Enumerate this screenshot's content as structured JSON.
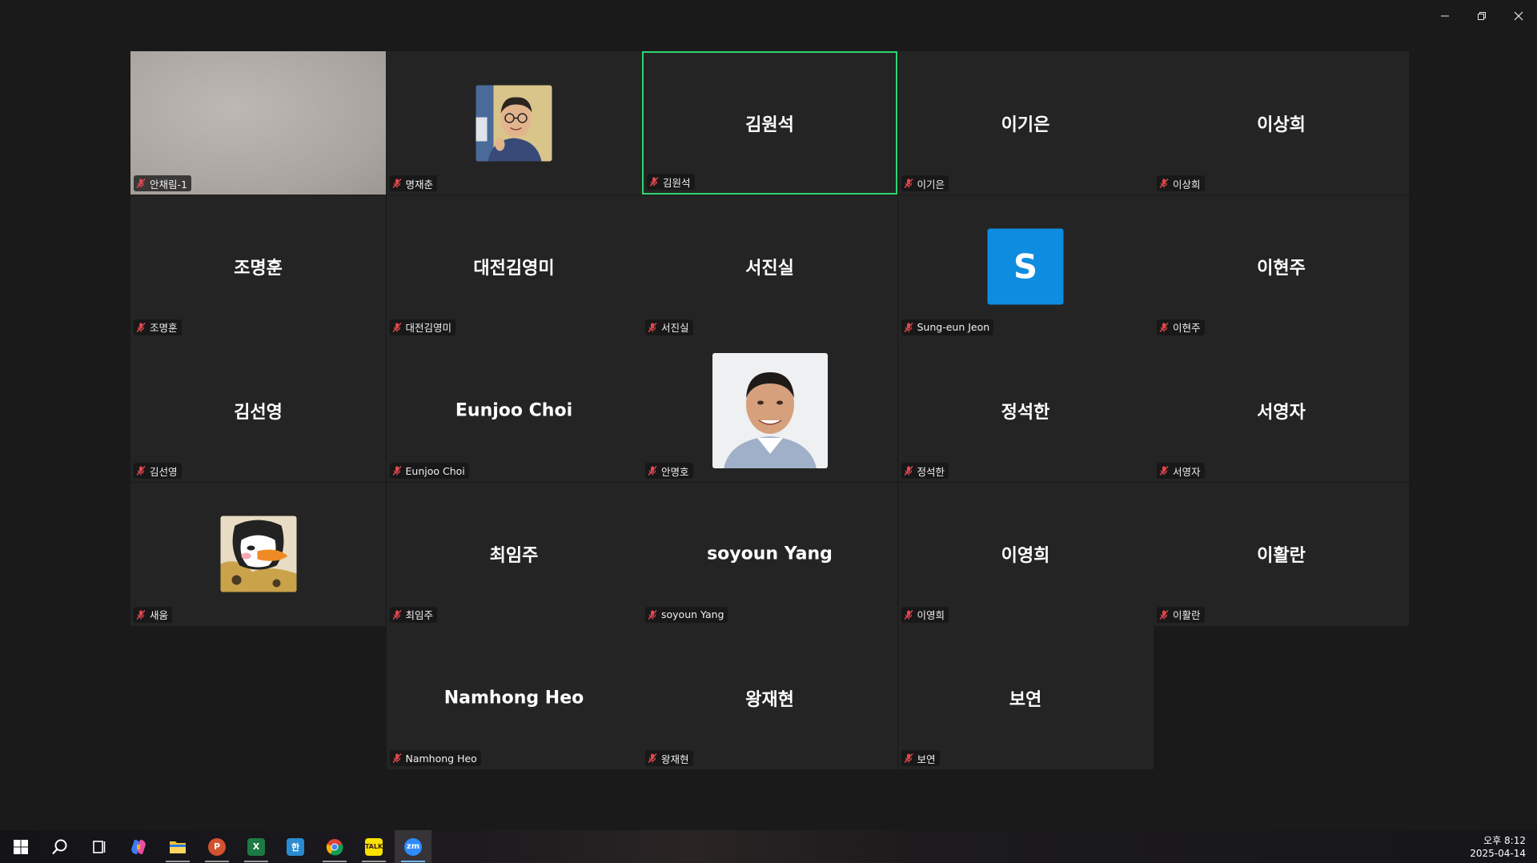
{
  "window": {
    "controls": [
      "minimize",
      "restore",
      "close"
    ]
  },
  "participants": [
    {
      "label": "안채림-1",
      "display": "video"
    },
    {
      "label": "명재춘",
      "display": "photo",
      "icon": "man-glasses-photo"
    },
    {
      "label": "김원석",
      "display": "name",
      "name": "김원석",
      "active": true
    },
    {
      "label": "이기은",
      "display": "name",
      "name": "이기은"
    },
    {
      "label": "이상희",
      "display": "name",
      "name": "이상희"
    },
    {
      "label": "조명훈",
      "display": "name",
      "name": "조명훈"
    },
    {
      "label": "대전김영미",
      "display": "name",
      "name": "대전김영미"
    },
    {
      "label": "서진실",
      "display": "name",
      "name": "서진실"
    },
    {
      "label": "Sung-eun Jeon",
      "display": "letter",
      "letter": "S"
    },
    {
      "label": "이현주",
      "display": "name",
      "name": "이현주"
    },
    {
      "label": "김선영",
      "display": "name",
      "name": "김선영"
    },
    {
      "label": "Eunjoo Choi",
      "display": "name",
      "name": "Eunjoo Choi"
    },
    {
      "label": "안명호",
      "display": "photo",
      "icon": "man-portrait-photo"
    },
    {
      "label": "정석한",
      "display": "name",
      "name": "정석한"
    },
    {
      "label": "서영자",
      "display": "name",
      "name": "서영자"
    },
    {
      "label": "새움",
      "display": "photo",
      "icon": "penguin-avatar"
    },
    {
      "label": "최임주",
      "display": "name",
      "name": "최임주"
    },
    {
      "label": "soyoun Yang",
      "display": "name",
      "name": "soyoun Yang"
    },
    {
      "label": "이영희",
      "display": "name",
      "name": "이영희"
    },
    {
      "label": "이활란",
      "display": "name",
      "name": "이활란"
    },
    {
      "label": "Namhong Heo",
      "display": "name",
      "name": "Namhong Heo"
    },
    {
      "label": "왕재현",
      "display": "name",
      "name": "왕재현"
    },
    {
      "label": "보연",
      "display": "name",
      "name": "보연"
    }
  ],
  "colors": {
    "active_speaker_border": "#2ed573",
    "tile_bg": "#242424",
    "mute_icon": "#e0474c",
    "avatar_letter_bg": "#0e8ce0"
  },
  "taskbar": {
    "apps": [
      {
        "name": "start-icon"
      },
      {
        "name": "search-icon"
      },
      {
        "name": "task-view-icon"
      },
      {
        "name": "copilot-icon"
      },
      {
        "name": "file-explorer-icon",
        "running": true
      },
      {
        "name": "powerpoint-icon",
        "running": true
      },
      {
        "name": "excel-icon",
        "running": true
      },
      {
        "name": "hangul-icon"
      },
      {
        "name": "chrome-icon",
        "running": true
      },
      {
        "name": "kakaotalk-icon",
        "running": true
      },
      {
        "name": "zoom-icon",
        "running": true,
        "focused": true
      }
    ],
    "time": "오후 8:12",
    "date": "2025-04-14"
  }
}
